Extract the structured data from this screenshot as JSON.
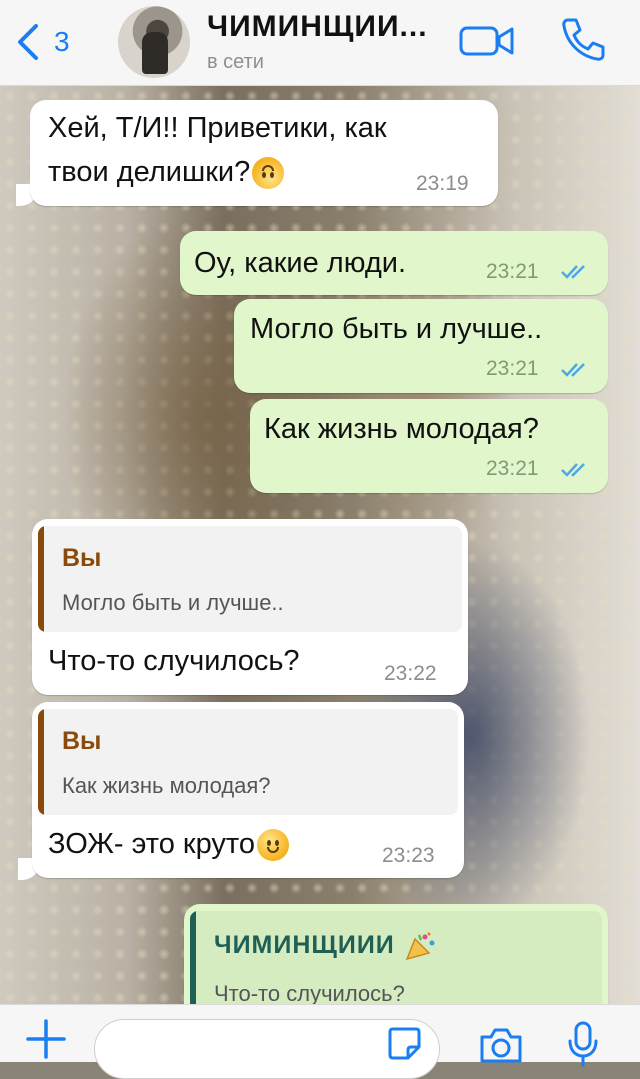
{
  "header": {
    "back_count": "3",
    "contact_name": "ЧИМИНЩИИ...",
    "status": "в сети"
  },
  "messages": [
    {
      "line1": "Хей, Т/И!! Приветики, как",
      "line2": "твои делишки?",
      "time": "23:19",
      "emoji": "upside-down-face"
    },
    {
      "text": "Оу, какие люди.",
      "time": "23:21"
    },
    {
      "text": "Могло быть и лучше..",
      "time": "23:21"
    },
    {
      "text": "Как жизнь молодая?",
      "time": "23:21"
    },
    {
      "quote_author": "Вы",
      "quote_text": "Могло быть и лучше..",
      "text": "Что-то случилось?",
      "time": "23:22"
    },
    {
      "quote_author": "Вы",
      "quote_text": "Как жизнь молодая?",
      "text": "ЗОЖ- это круто",
      "time": "23:23",
      "emoji": "slightly-smiling-face"
    },
    {
      "quote_author": "ЧИМИНЩИИИ",
      "quote_text": "Что-то случилось?",
      "emoji": "party-popper"
    }
  ],
  "colors": {
    "accent": "#1a7ef2",
    "outgoing_bubble": "#e1f7cb",
    "incoming_bubble": "#ffffff",
    "quote_author_self": "#8a4a0b",
    "quote_author_contact": "#1f5f54",
    "read_ticks": "#4fa7e8"
  },
  "icons": [
    "chevron-left-icon",
    "video-camera-icon",
    "phone-icon",
    "plus-icon",
    "sticker-icon",
    "camera-icon",
    "microphone-icon"
  ]
}
